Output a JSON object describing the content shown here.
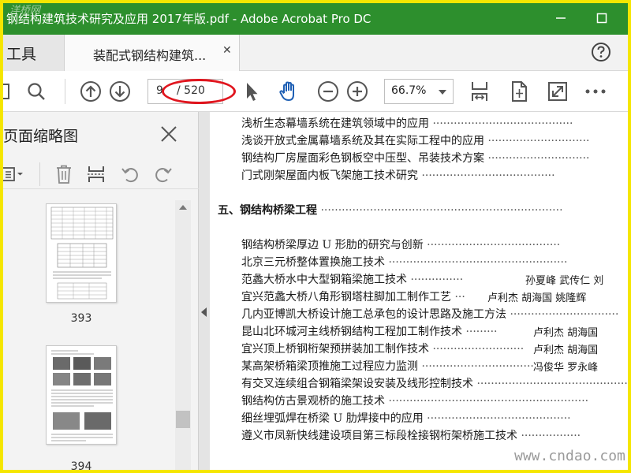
{
  "window": {
    "title": "钢结构建筑技术研究及应用  2017年版.pdf - Adobe Acrobat Pro DC",
    "watermark": "洋桥网"
  },
  "tabs": {
    "tools": "工具",
    "document": "装配式钢结构建筑..."
  },
  "toolbar": {
    "current_page": "9",
    "total_pages": "/ 520",
    "zoom": "66.7%"
  },
  "sidebar": {
    "title": "页面缩略图",
    "thumbnails": [
      {
        "page": "393"
      },
      {
        "page": "394"
      }
    ]
  },
  "document": {
    "lines_top": [
      {
        "text": "浅析生态幕墙系统在建筑领域中的应用",
        "authors": ""
      },
      {
        "text": "浅谈开放式金属幕墙系统及其在实际工程中的应用",
        "authors": ""
      },
      {
        "text": "钢结构厂房屋面彩色钢板空中压型、吊装技术方案",
        "authors": ""
      },
      {
        "text": "门式刚架屋面内板飞架施工技术研究",
        "authors": ""
      }
    ],
    "section_title": "五、钢结构桥梁工程",
    "lines_bottom": [
      {
        "text": "钢结构桥梁厚边 U 形肋的研究与创新",
        "authors": ""
      },
      {
        "text": "北京三元桥整体置换施工技术",
        "authors": ""
      },
      {
        "text": "范蠡大桥水中大型钢箱梁施工技术",
        "authors": "孙夏峰   武传仁   刘"
      },
      {
        "text": "宜兴范蠡大桥八角形钢塔柱脚加工制作工艺",
        "authors": "卢利杰   胡海国   姚隆辉"
      },
      {
        "text": "几内亚博凯大桥设计施工总承包的设计思路及施工方法",
        "authors": ""
      },
      {
        "text": "昆山北环城河主线桥钢结构工程加工制作技术",
        "authors": "卢利杰   胡海国"
      },
      {
        "text": "宜兴顶上桥钢桁架预拼装加工制作技术",
        "authors": "卢利杰   胡海国"
      },
      {
        "text": "某高架桥箱梁顶推施工过程应力监测",
        "authors": "冯俊华   罗永峰"
      },
      {
        "text": "有交叉连续组合钢箱梁架设安装及线形控制技术",
        "authors": ""
      },
      {
        "text": "钢结构仿古景观桥的施工技术",
        "authors": ""
      },
      {
        "text": "细丝埋弧焊在桥梁 U 肋焊接中的应用",
        "authors": ""
      },
      {
        "text": "遵义市凤新快线建设项目第三标段栓接钢桁架桥施工技术",
        "authors": ""
      }
    ],
    "watermark": "www.cndao.com"
  },
  "colors": {
    "titlebar": "#2d8f2d",
    "frame": "#f5e600",
    "annotation": "#e0151e",
    "icon_blue": "#1e5fb4"
  }
}
